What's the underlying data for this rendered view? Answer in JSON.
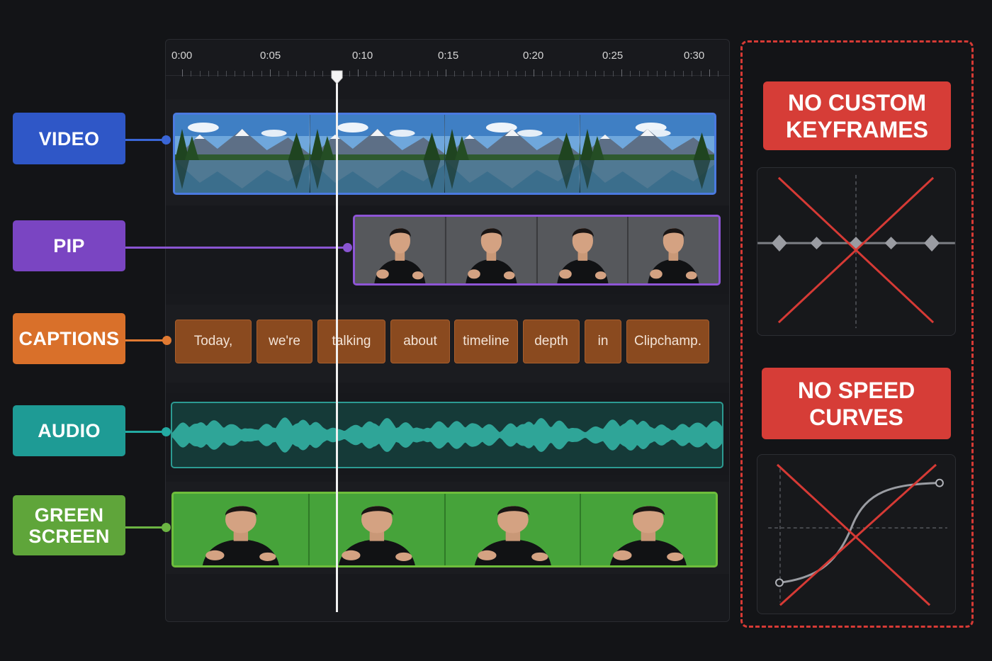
{
  "ruler": {
    "ticks": [
      "0:00",
      "0:05",
      "0:10",
      "0:15",
      "0:20",
      "0:25",
      "0:30"
    ]
  },
  "tracks": {
    "video": {
      "label": "VIDEO",
      "color": "#2f57c7"
    },
    "pip": {
      "label": "PIP",
      "color": "#7a45c2"
    },
    "captions": {
      "label": "CAPTIONS",
      "color": "#d9702a"
    },
    "audio": {
      "label": "AUDIO",
      "color": "#1e9b95"
    },
    "green_screen": {
      "label_line1": "GREEN",
      "label_line2": "SCREEN",
      "color": "#5fa53a"
    }
  },
  "captions": {
    "words": [
      "Today,",
      "we're",
      "talking",
      "about",
      "timeline",
      "depth",
      "in",
      "Clipchamp."
    ]
  },
  "playhead": {
    "time": "0:09"
  },
  "limitations": {
    "keyframes": {
      "line1": "NO CUSTOM",
      "line2": "KEYFRAMES",
      "icon": "keyframe-graph-crossed-icon"
    },
    "speed": {
      "line1": "NO SPEED",
      "line2": "CURVES",
      "icon": "speed-curve-crossed-icon"
    }
  },
  "colors": {
    "background": "#131417",
    "limit_red": "#d63d37"
  }
}
